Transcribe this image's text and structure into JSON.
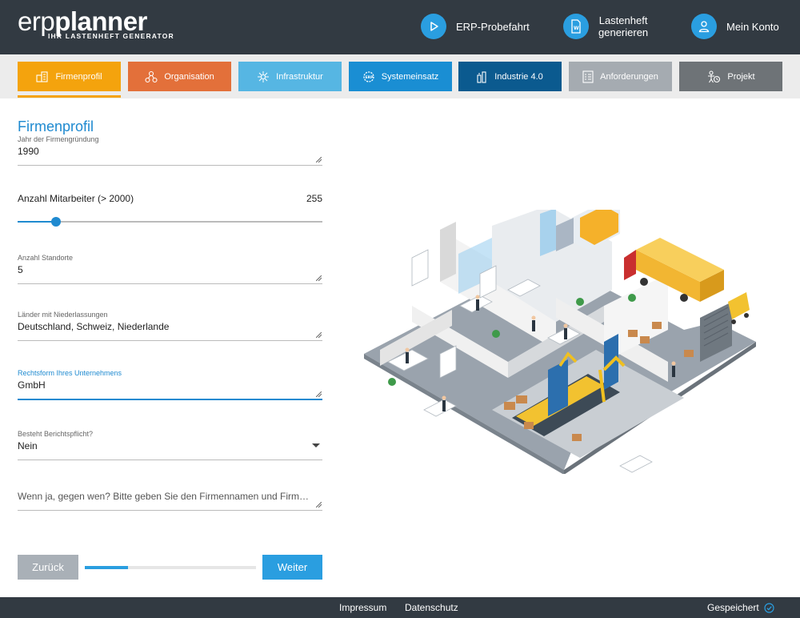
{
  "header": {
    "logo_prefix": "erp",
    "logo_main": "planner",
    "logo_tagline": "IHR LASTENHEFT GENERATOR",
    "test_drive_label": "ERP-Probefahrt",
    "generate_line1": "Lastenheft",
    "generate_line2": "generieren",
    "account_label": "Mein Konto"
  },
  "tabs": [
    {
      "label": "Firmenprofil",
      "color": "#f4a30d"
    },
    {
      "label": "Organisation",
      "color": "#e3703a"
    },
    {
      "label": "Infrastruktur",
      "color": "#56b6e3"
    },
    {
      "label": "Systemeinsatz",
      "color": "#1a8ed3"
    },
    {
      "label": "Industrie 4.0",
      "color": "#0b5a8f"
    },
    {
      "label": "Anforderungen",
      "color": "#a5abb1"
    },
    {
      "label": "Projekt",
      "color": "#6e7377"
    }
  ],
  "form": {
    "title": "Firmenprofil",
    "founding_year": {
      "label": "Jahr der Firmengründung",
      "value": "1990"
    },
    "employees": {
      "label": "Anzahl Mitarbeiter (> 2000)",
      "value": "255",
      "slider_fraction": 0.127
    },
    "locations": {
      "label": "Anzahl Standorte",
      "value": "5"
    },
    "countries": {
      "label": "Länder mit Niederlassungen",
      "value": "Deutschland, Schweiz, Niederlande"
    },
    "legal_form": {
      "label": "Rechtsform Ihres Unternehmens",
      "value": "GmbH"
    },
    "reporting": {
      "label": "Besteht Berichtspflicht?",
      "value": "Nein"
    },
    "reporting_to": {
      "placeholder": "Wenn ja, gegen wen? Bitte geben Sie den Firmennamen und Firme..."
    }
  },
  "nav": {
    "back_label": "Zurück",
    "next_label": "Weiter",
    "progress_fraction": 0.25
  },
  "footer": {
    "imprint": "Impressum",
    "privacy": "Datenschutz",
    "status": "Gespeichert"
  },
  "colors": {
    "header_bg": "#323a42",
    "accent": "#1f8ad0",
    "button_blue": "#2a9ee0"
  }
}
